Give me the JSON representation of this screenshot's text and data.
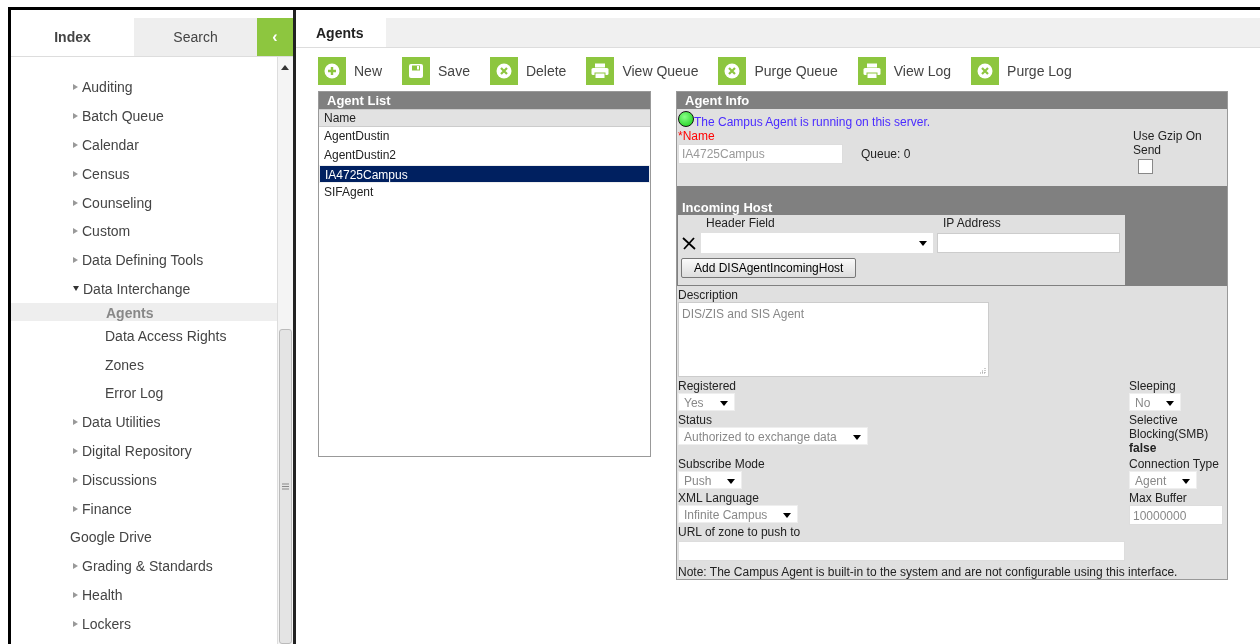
{
  "sidebar": {
    "tabs": [
      {
        "label": "Index",
        "selected": true
      },
      {
        "label": "Search",
        "selected": false
      }
    ],
    "collapse_button": "‹",
    "items": [
      {
        "label": "Auditing",
        "kind": "folder",
        "expanded": false,
        "selected": false
      },
      {
        "label": "Batch Queue",
        "kind": "folder",
        "expanded": false,
        "selected": false
      },
      {
        "label": "Calendar",
        "kind": "folder",
        "expanded": false,
        "selected": false
      },
      {
        "label": "Census",
        "kind": "folder",
        "expanded": false,
        "selected": false
      },
      {
        "label": "Counseling",
        "kind": "folder",
        "expanded": false,
        "selected": false
      },
      {
        "label": "Custom",
        "kind": "folder",
        "expanded": false,
        "selected": false
      },
      {
        "label": "Data Defining Tools",
        "kind": "folder",
        "expanded": false,
        "selected": false
      },
      {
        "label": "Data Interchange",
        "kind": "folder",
        "expanded": true,
        "selected": false,
        "children": [
          {
            "label": "Agents",
            "selected": true
          },
          {
            "label": "Data Access Rights",
            "selected": false
          },
          {
            "label": "Zones",
            "selected": false
          },
          {
            "label": "Error Log",
            "selected": false
          }
        ]
      },
      {
        "label": "Data Utilities",
        "kind": "folder",
        "expanded": false,
        "selected": false
      },
      {
        "label": "Digital Repository",
        "kind": "folder",
        "expanded": false,
        "selected": false
      },
      {
        "label": "Discussions",
        "kind": "folder",
        "expanded": false,
        "selected": false
      },
      {
        "label": "Finance",
        "kind": "folder",
        "expanded": false,
        "selected": false
      },
      {
        "label": "Google Drive",
        "kind": "page",
        "selected": false
      },
      {
        "label": "Grading & Standards",
        "kind": "folder",
        "expanded": false,
        "selected": false
      },
      {
        "label": "Health",
        "kind": "folder",
        "expanded": false,
        "selected": false
      },
      {
        "label": "Lockers",
        "kind": "folder",
        "expanded": false,
        "selected": false
      }
    ]
  },
  "main": {
    "tab": {
      "label": "Agents"
    },
    "toolbar": [
      {
        "kind": "add",
        "label": "New"
      },
      {
        "kind": "save",
        "label": "Save"
      },
      {
        "kind": "delete",
        "label": "Delete"
      },
      {
        "kind": "print",
        "label": "View Queue"
      },
      {
        "kind": "delete",
        "label": "Purge Queue"
      },
      {
        "kind": "print",
        "label": "View Log"
      },
      {
        "kind": "delete",
        "label": "Purge Log"
      }
    ],
    "agent_list": {
      "title": "Agent List",
      "column": "Name",
      "rows": [
        {
          "name": "AgentDustin",
          "selected": false
        },
        {
          "name": "AgentDustin2",
          "selected": false
        },
        {
          "name": "IA4725Campus",
          "selected": true
        },
        {
          "name": "SIFAgent",
          "selected": false
        }
      ]
    },
    "agent_info": {
      "title": "Agent Info",
      "running": true,
      "status_message": "The Campus Agent is running on this server.",
      "name_label": "*Name",
      "name_value": "IA4725Campus",
      "queue": "Queue: 0",
      "gzip_label": "Use Gzip On Send",
      "gzip_checked": false,
      "incoming_host": {
        "title": "Incoming Host",
        "columns": [
          "Header Field",
          "IP Address"
        ],
        "add_button": "Add DISAgentIncomingHost"
      },
      "description_label": "Description",
      "description_value": "DIS/ZIS and SIS Agent",
      "rows": [
        {
          "left": {
            "label": "Registered",
            "kind": "select",
            "value": "Yes"
          },
          "right": {
            "label": "Sleeping",
            "kind": "select",
            "value": "No"
          }
        },
        {
          "left": {
            "label": "Status",
            "kind": "select",
            "value": "Authorized to exchange data"
          },
          "right": {
            "label": "Selective Blocking(SMB)",
            "kind": "text",
            "value": "false"
          }
        },
        {
          "left": {
            "label": "Subscribe Mode",
            "kind": "select",
            "value": "Push"
          },
          "right": {
            "label": "Connection Type",
            "kind": "select",
            "value": "Agent"
          }
        },
        {
          "left": {
            "label": "XML Language",
            "kind": "select",
            "value": "Infinite Campus"
          },
          "right": {
            "label": "Max Buffer",
            "kind": "input",
            "value": "10000000"
          }
        }
      ],
      "url_label": "URL of zone to push to",
      "note": "Note: The Campus Agent is built-in to the system and are not configurable using this interface."
    }
  }
}
